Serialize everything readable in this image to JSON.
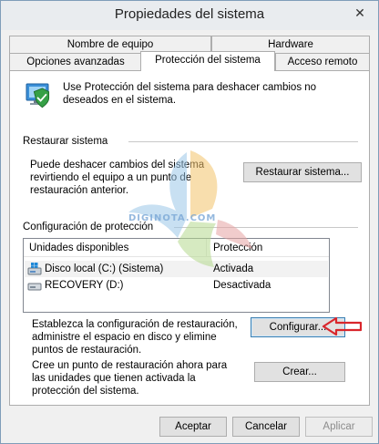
{
  "window": {
    "title": "Propiedades del sistema",
    "close_glyph": "✕"
  },
  "tabs": {
    "row1": [
      {
        "label": "Nombre de equipo"
      },
      {
        "label": "Hardware"
      }
    ],
    "row2": [
      {
        "label": "Opciones avanzadas"
      },
      {
        "label": "Protección del sistema",
        "active": true
      },
      {
        "label": "Acceso remoto"
      }
    ]
  },
  "panel": {
    "intro": "Use Protección del sistema para deshacer cambios no deseados en el sistema.",
    "restore": {
      "title": "Restaurar sistema",
      "description": "Puede deshacer cambios del sistema revirtiendo el equipo a un punto de restauración anterior.",
      "button_label": "Restaurar sistema..."
    },
    "protection": {
      "title": "Configuración de protección",
      "columns": [
        "Unidades disponibles",
        "Protección"
      ],
      "rows": [
        {
          "drive": "Disco local (C:) (Sistema)",
          "status": "Activada",
          "icon": "system-drive-icon"
        },
        {
          "drive": "RECOVERY (D:)",
          "status": "Desactivada",
          "icon": "drive-icon"
        }
      ],
      "configure_text": "Establezca la configuración de restauración, administre el espacio en disco y elimine puntos de restauración.",
      "configure_button": "Configurar...",
      "create_text": "Cree un punto de restauración ahora para las unidades que tienen activada la protección del sistema.",
      "create_button": "Crear..."
    }
  },
  "footer": {
    "accept": "Aceptar",
    "cancel": "Cancelar",
    "apply": "Aplicar"
  },
  "watermark": "DIGINOTA.COM",
  "colors": {
    "annotation_arrow": "#d9262c",
    "panel_bg": "#ffffff",
    "window_bg": "#f0f0f0"
  }
}
